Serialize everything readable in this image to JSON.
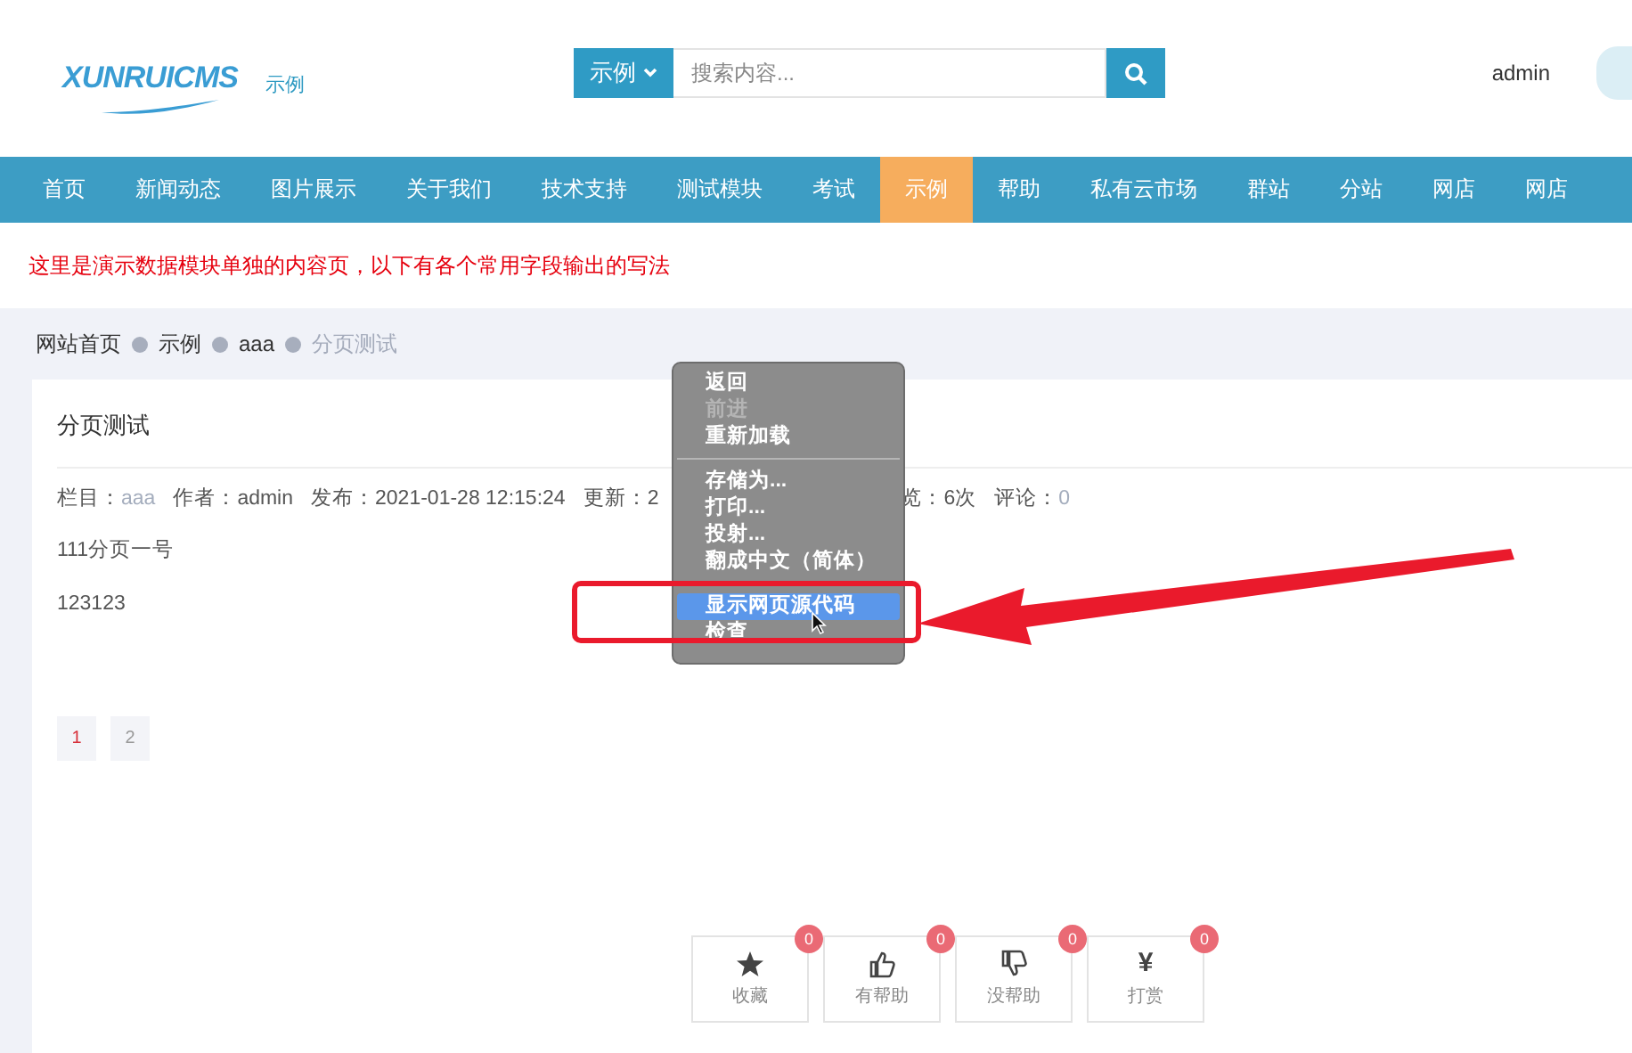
{
  "header": {
    "logo": "XUNRUICMS",
    "site_label": "示例",
    "search": {
      "scope": "示例",
      "placeholder": "搜索内容..."
    },
    "user": "admin"
  },
  "nav": [
    {
      "label": "首页",
      "selected": false
    },
    {
      "label": "新闻动态",
      "selected": false
    },
    {
      "label": "图片展示",
      "selected": false
    },
    {
      "label": "关于我们",
      "selected": false
    },
    {
      "label": "技术支持",
      "selected": false
    },
    {
      "label": "测试模块",
      "selected": false
    },
    {
      "label": "考试",
      "selected": false
    },
    {
      "label": "示例",
      "selected": true
    },
    {
      "label": "帮助",
      "selected": false
    },
    {
      "label": "私有云市场",
      "selected": false
    },
    {
      "label": "群站",
      "selected": false
    },
    {
      "label": "分站",
      "selected": false
    },
    {
      "label": "网店",
      "selected": false
    },
    {
      "label": "网店",
      "selected": false
    }
  ],
  "notice": "这里是演示数据模块单独的内容页，以下有各个常用字段输出的写法",
  "breadcrumb": [
    {
      "label": "网站首页",
      "current": false
    },
    {
      "label": "示例",
      "current": false
    },
    {
      "label": "aaa",
      "current": false
    },
    {
      "label": "分页测试",
      "current": true
    }
  ],
  "article": {
    "title": "分页测试",
    "meta": [
      {
        "label": "栏目：",
        "value": "aaa",
        "kind": "link"
      },
      {
        "label": "作者：",
        "value": "admin",
        "kind": "plain"
      },
      {
        "label": "发布：",
        "value": "2021-01-28 12:15:24",
        "kind": "plain"
      },
      {
        "label": "更新：",
        "value": "2",
        "kind": "plain"
      },
      {
        "label": "览：",
        "value": "6次",
        "kind": "plain"
      },
      {
        "label": "评论：",
        "value": "0",
        "kind": "link"
      }
    ],
    "paragraphs": [
      "111分页一号",
      "123123"
    ],
    "pagination": [
      {
        "label": "1",
        "selected": true
      },
      {
        "label": "2",
        "selected": false
      }
    ],
    "actions": [
      {
        "kind": "star",
        "label": "收藏",
        "count": "0"
      },
      {
        "kind": "thumb-up",
        "label": "有帮助",
        "count": "0"
      },
      {
        "kind": "thumb-down",
        "label": "没帮助",
        "count": "0"
      },
      {
        "kind": "glyph",
        "glyph": "¥",
        "label": "打赏",
        "count": "0"
      }
    ]
  },
  "context_menu": {
    "items": [
      {
        "kind": "item",
        "label": "返回",
        "disabled": false,
        "selected": false
      },
      {
        "kind": "item",
        "label": "前进",
        "disabled": true,
        "selected": false
      },
      {
        "kind": "item",
        "label": "重新加载",
        "disabled": false,
        "selected": false
      },
      {
        "kind": "separator"
      },
      {
        "kind": "item",
        "label": "存储为...",
        "disabled": false,
        "selected": false
      },
      {
        "kind": "item",
        "label": "打印...",
        "disabled": false,
        "selected": false
      },
      {
        "kind": "item",
        "label": "投射...",
        "disabled": false,
        "selected": false
      },
      {
        "kind": "item",
        "label": "翻成中文（简体）",
        "disabled": false,
        "selected": false
      },
      {
        "kind": "separator"
      },
      {
        "kind": "item",
        "label": "显示网页源代码",
        "disabled": false,
        "selected": true
      },
      {
        "kind": "item",
        "label": "检查",
        "disabled": false,
        "selected": false
      }
    ]
  }
}
